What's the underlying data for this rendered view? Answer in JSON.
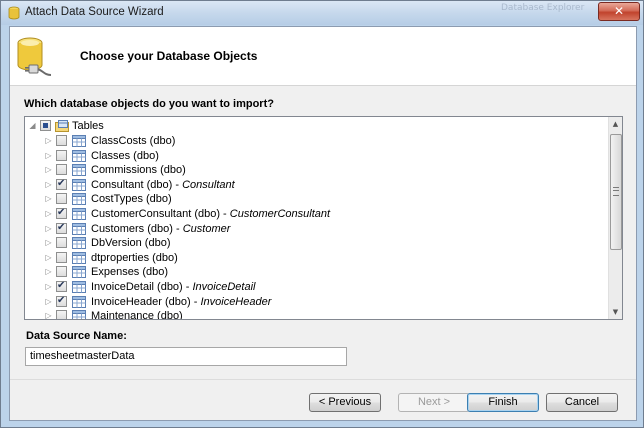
{
  "window": {
    "title": "Attach Data Source Wizard",
    "close_label": "✕",
    "background_text": "Database Explorer"
  },
  "header": {
    "title": "Choose your Database Objects",
    "icon": "database-plug-icon"
  },
  "question": "Which database objects do you want to import?",
  "tree": {
    "root": {
      "label": "Tables",
      "state": "partial",
      "expanded": true
    },
    "items": [
      {
        "name": "ClassCosts (dbo)",
        "alias": "",
        "checked": false
      },
      {
        "name": "Classes (dbo)",
        "alias": "",
        "checked": false
      },
      {
        "name": "Commissions (dbo)",
        "alias": "",
        "checked": false
      },
      {
        "name": "Consultant (dbo) - ",
        "alias": "Consultant",
        "checked": true
      },
      {
        "name": "CostTypes (dbo)",
        "alias": "",
        "checked": false
      },
      {
        "name": "CustomerConsultant (dbo) - ",
        "alias": "CustomerConsultant",
        "checked": true
      },
      {
        "name": "Customers (dbo) - ",
        "alias": "Customer",
        "checked": true
      },
      {
        "name": "DbVersion (dbo)",
        "alias": "",
        "checked": false
      },
      {
        "name": "dtproperties (dbo)",
        "alias": "",
        "checked": false
      },
      {
        "name": "Expenses (dbo)",
        "alias": "",
        "checked": false
      },
      {
        "name": "InvoiceDetail (dbo) - ",
        "alias": "InvoiceDetail",
        "checked": true
      },
      {
        "name": "InvoiceHeader (dbo) - ",
        "alias": "InvoiceHeader",
        "checked": true
      },
      {
        "name": "Maintenance (dbo)",
        "alias": "",
        "checked": false
      }
    ]
  },
  "datasource": {
    "label": "Data Source Name:",
    "value": "timesheetmasterData"
  },
  "buttons": {
    "previous": "< Previous",
    "next": "Next >",
    "finish": "Finish",
    "cancel": "Cancel"
  }
}
